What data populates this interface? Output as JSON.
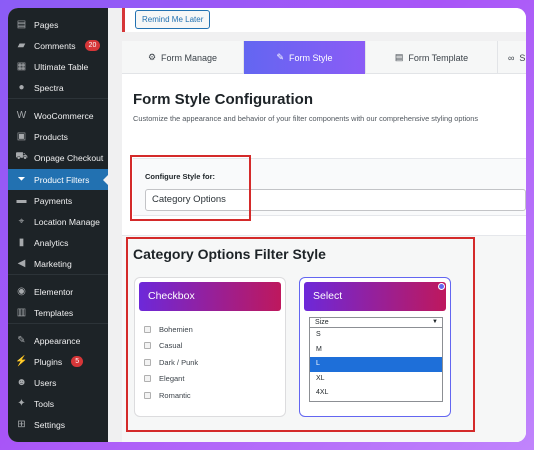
{
  "sidebar": {
    "items": [
      {
        "label": "Pages",
        "icon": "pages-icon",
        "glyph": "▤"
      },
      {
        "label": "Comments",
        "icon": "comments-icon",
        "glyph": "▰",
        "badge": "20"
      },
      {
        "label": "Ultimate Table",
        "icon": "table-icon",
        "glyph": "▦"
      },
      {
        "label": "Spectra",
        "icon": "spectra-icon",
        "glyph": "●"
      },
      {
        "label": "WooCommerce",
        "icon": "woocommerce-icon",
        "glyph": "W"
      },
      {
        "label": "Products",
        "icon": "products-icon",
        "glyph": "▣"
      },
      {
        "label": "Onpage Checkout",
        "icon": "cart-icon",
        "glyph": "⛟"
      },
      {
        "label": "Product Filters",
        "icon": "filter-icon",
        "glyph": "⏷",
        "active": true
      },
      {
        "label": "Payments",
        "icon": "payments-icon",
        "glyph": "▬"
      },
      {
        "label": "Location Manage",
        "icon": "location-icon",
        "glyph": "⌖"
      },
      {
        "label": "Analytics",
        "icon": "analytics-icon",
        "glyph": "▮"
      },
      {
        "label": "Marketing",
        "icon": "marketing-icon",
        "glyph": "◀"
      },
      {
        "label": "Elementor",
        "icon": "elementor-icon",
        "glyph": "◉"
      },
      {
        "label": "Templates",
        "icon": "templates-icon",
        "glyph": "▥"
      },
      {
        "label": "Appearance",
        "icon": "appearance-icon",
        "glyph": "✎"
      },
      {
        "label": "Plugins",
        "icon": "plugins-icon",
        "glyph": "⚡",
        "badge": "5"
      },
      {
        "label": "Users",
        "icon": "users-icon",
        "glyph": "☻"
      },
      {
        "label": "Tools",
        "icon": "tools-icon",
        "glyph": "✦"
      },
      {
        "label": "Settings",
        "icon": "settings-icon",
        "glyph": "⊞"
      }
    ]
  },
  "notice": {
    "remind_label": "Remind Me Later"
  },
  "tabs": [
    {
      "label": "Form Manage",
      "icon": "manage-icon",
      "glyph": "⚙"
    },
    {
      "label": "Form Style",
      "icon": "brush-icon",
      "glyph": "✎",
      "active": true
    },
    {
      "label": "Form Template",
      "icon": "template-icon",
      "glyph": "▤"
    },
    {
      "label": "SEO",
      "icon": "link-icon",
      "glyph": "∞"
    }
  ],
  "config": {
    "title": "Form Style Configuration",
    "description": "Customize the appearance and behavior of your filter components with our comprehensive styling options",
    "label": "Configure Style for:",
    "value": "Category Options"
  },
  "filter_style": {
    "title": "Category Options Filter Style",
    "checkbox_card": {
      "title": "Checkbox",
      "options": [
        "Bohemien",
        "Casual",
        "Dark / Punk",
        "Elegant",
        "Romantic"
      ]
    },
    "select_card": {
      "title": "Select",
      "placeholder": "Size",
      "options": [
        "S",
        "M",
        "L",
        "XL",
        "4XL"
      ],
      "highlighted": "L"
    }
  }
}
